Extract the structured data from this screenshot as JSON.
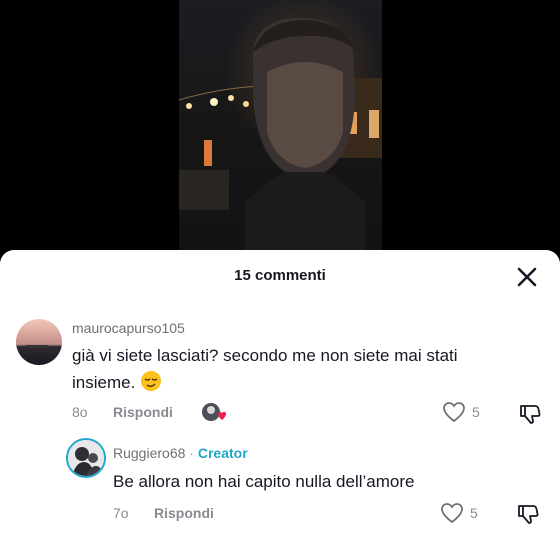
{
  "sheet": {
    "title": "15 commenti"
  },
  "comments": [
    {
      "username": "maurocapurso105",
      "text_line1": "già vi siete lasciati? secondo me non siete mai stati",
      "text_line2": "insieme.",
      "time": "8o",
      "reply_label": "Rispondi",
      "likes": "5"
    },
    {
      "username": "Ruggiero68",
      "separator": "·",
      "badge": "Creator",
      "text_line1": "Be allora non hai capito nulla dell’amore",
      "time": "7o",
      "reply_label": "Rispondi",
      "likes": "5"
    }
  ],
  "colors": {
    "creator_badge": "#20a7c9",
    "text": "#161823",
    "meta": "#8a8b91",
    "like_heart": "#ee1d52"
  }
}
